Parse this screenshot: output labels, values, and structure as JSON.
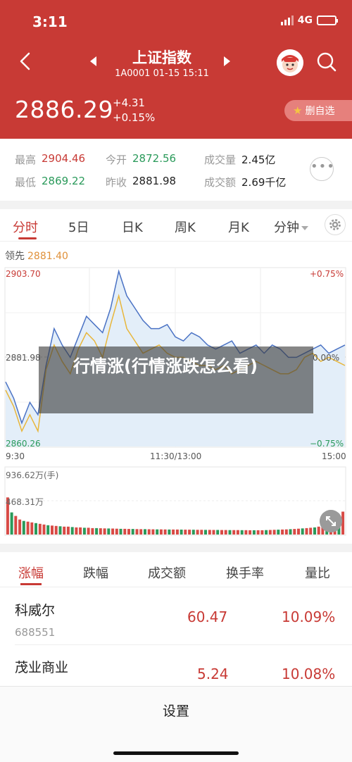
{
  "status_bar": {
    "time": "3:11",
    "network": "4G"
  },
  "header": {
    "title": "上证指数",
    "subtitle": "1A0001  01-15 15:11",
    "price": "2886.29",
    "change_abs": "+4.31",
    "change_pct": "+0.15%",
    "watch_label": "删自选",
    "bg_color": "#c83a35"
  },
  "stats": {
    "high_label": "最高",
    "high": "2904.46",
    "open_label": "今开",
    "open": "2872.56",
    "volume_label": "成交量",
    "volume": "2.45亿",
    "low_label": "最低",
    "low": "2869.22",
    "prev_label": "昨收",
    "prev": "2881.98",
    "amount_label": "成交额",
    "amount": "2.69千亿",
    "more_label": "•••"
  },
  "chart_tabs": [
    "分时",
    "5日",
    "日K",
    "周K",
    "月K",
    "分钟"
  ],
  "chart": {
    "prev_close_label": "领先",
    "prev_close_value": "2881.40",
    "y_top": "2903.70",
    "y_mid": "2881.98",
    "y_bottom": "2860.26",
    "pct_top": "+0.75%",
    "pct_mid": "0.00%",
    "pct_bottom": "−0.75%",
    "x_start": "9:30",
    "x_mid": "11:30/13:00",
    "x_end": "15:00",
    "vol_top": "936.62万(手)",
    "vol_mid": "468.31万"
  },
  "chart_data": {
    "type": "line",
    "xlabel": "",
    "ylabel": "",
    "ylim": [
      2860.26,
      2903.7
    ],
    "x_ticks": [
      "9:30",
      "11:30/13:00",
      "15:00"
    ],
    "series": [
      {
        "values": [
          2876,
          2872,
          2866,
          2871,
          2868,
          2880,
          2889,
          2885,
          2882,
          2887,
          2892,
          2890,
          2888,
          2894,
          2903,
          2897,
          2894,
          2891,
          2889,
          2889,
          2890,
          2887,
          2886,
          2888,
          2887,
          2885,
          2884,
          2885,
          2886,
          2883,
          2884,
          2885,
          2883,
          2885,
          2884,
          2882,
          2882,
          2883,
          2884,
          2885,
          2883,
          2884,
          2885
        ]
      },
      {
        "values": [
          2874,
          2870,
          2864,
          2868,
          2864,
          2879,
          2885,
          2881,
          2878,
          2884,
          2888,
          2886,
          2882,
          2890,
          2897,
          2889,
          2886,
          2883,
          2884,
          2885,
          2883,
          2882,
          2882,
          2881,
          2880,
          2880,
          2879,
          2880,
          2878,
          2879,
          2880,
          2881,
          2880,
          2879,
          2878,
          2878,
          2879,
          2882,
          2883,
          2881,
          2882,
          2881,
          2880
        ]
      }
    ],
    "volume_ylim": [
      0,
      936.62
    ],
    "volumes": [
      520,
      310,
      260,
      210,
      190,
      180,
      170,
      160,
      150,
      140,
      130,
      125,
      120,
      115,
      110,
      110,
      105,
      100,
      100,
      95,
      95,
      90,
      90,
      88,
      86,
      85,
      84,
      82,
      80,
      80,
      78,
      78,
      76,
      75,
      75,
      74,
      73,
      72,
      72,
      71,
      70,
      70,
      70,
      69,
      68,
      68,
      67,
      66,
      66,
      65,
      65,
      64,
      64,
      63,
      63,
      62,
      62,
      62,
      61,
      61,
      60,
      60,
      60,
      60,
      62,
      64,
      66,
      68,
      70,
      72,
      75,
      78,
      82,
      86,
      90,
      95,
      100,
      110,
      120,
      140,
      160,
      190,
      230,
      320
    ]
  },
  "ranking": {
    "tabs": [
      "涨幅",
      "跌幅",
      "成交额",
      "换手率",
      "量比"
    ],
    "rows": [
      {
        "name": "科威尔",
        "code": "688551",
        "price": "60.47",
        "pct": "10.09%"
      },
      {
        "name": "茂业商业",
        "code": "",
        "price": "5.24",
        "pct": "10.08%"
      }
    ]
  },
  "overlay_text": "行情涨(行情涨跌怎么看)",
  "settings_label": "设置"
}
